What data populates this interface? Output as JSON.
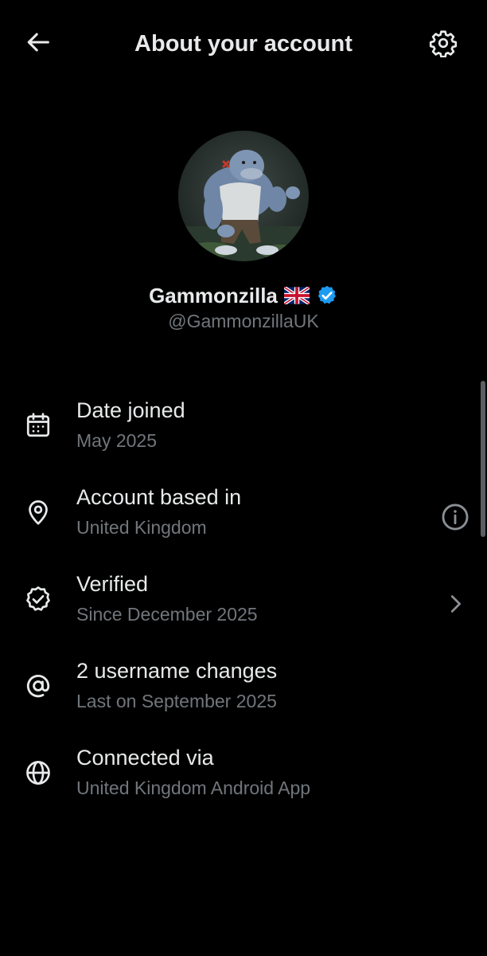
{
  "header": {
    "title": "About your account",
    "back_icon": "arrow-left-icon",
    "settings_icon": "gear-icon"
  },
  "profile": {
    "display_name": "Gammonzilla",
    "flag": "🇬🇧",
    "verified": true,
    "handle": "@GammonzillaUK",
    "avatar_icon": "avatar-image"
  },
  "rows": [
    {
      "label": "Date joined",
      "value": "May 2025",
      "icon": "calendar-icon",
      "trailing": ""
    },
    {
      "label": "Account based in",
      "value": "United Kingdom",
      "icon": "location-pin-icon",
      "trailing": "info-icon"
    },
    {
      "label": "Verified",
      "value": "Since December 2025",
      "icon": "verified-badge-icon",
      "trailing": "chevron-right-icon"
    },
    {
      "label": "2 username changes",
      "value": "Last on September 2025",
      "icon": "at-sign-icon",
      "trailing": ""
    },
    {
      "label": "Connected via",
      "value": "United Kingdom Android App",
      "icon": "globe-icon",
      "trailing": ""
    }
  ],
  "colors": {
    "background": "#000000",
    "primary_text": "#E7E9EA",
    "secondary_text": "#71767B",
    "verified_blue": "#1D9BF0"
  }
}
